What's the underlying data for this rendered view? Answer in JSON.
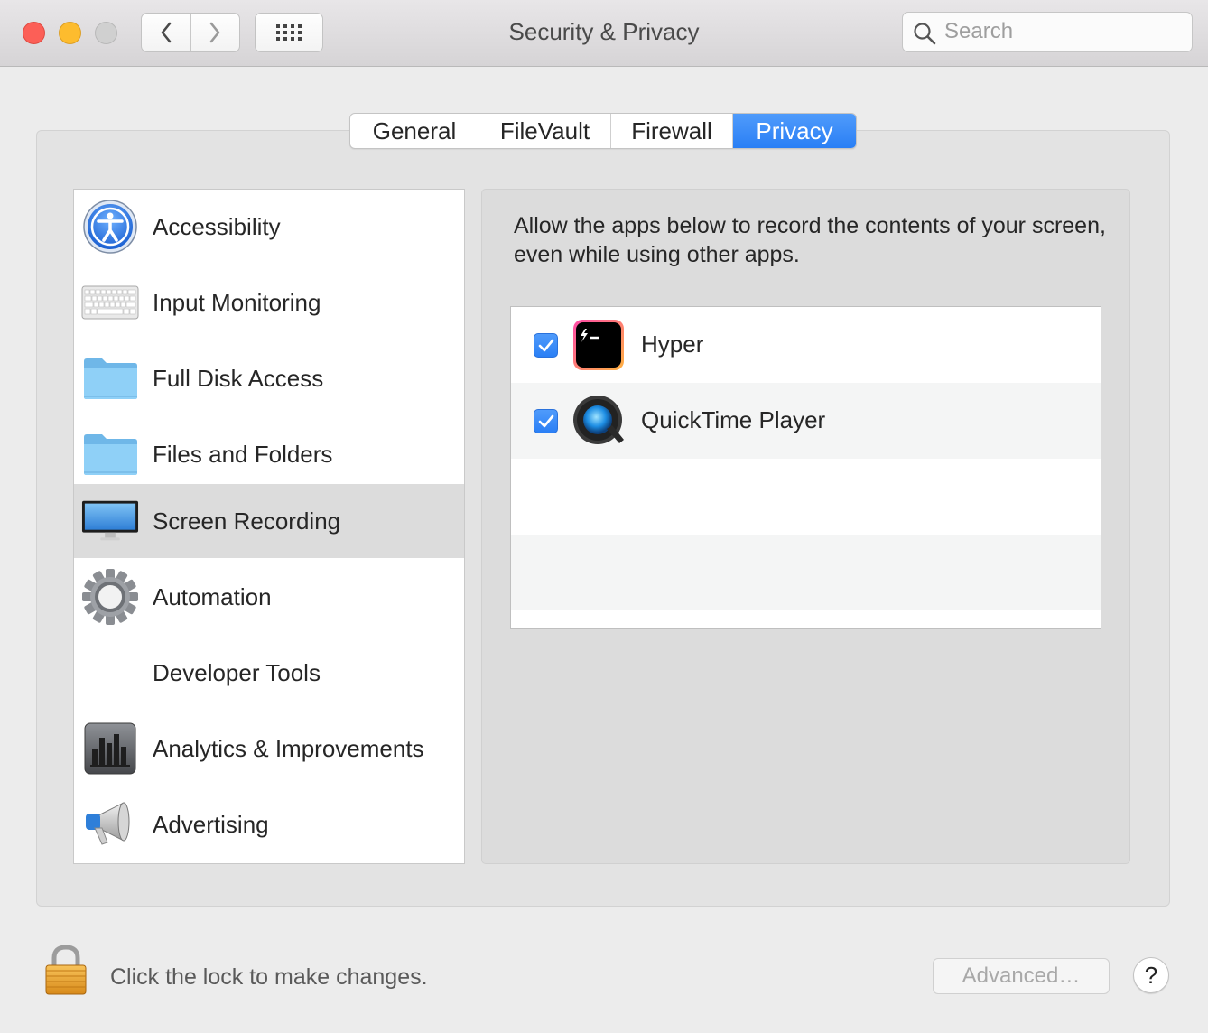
{
  "window": {
    "title": "Security & Privacy"
  },
  "toolbar": {
    "back_icon": "chevron-left-icon",
    "forward_icon": "chevron-right-icon",
    "grid_icon": "show-all-grid-icon"
  },
  "search": {
    "placeholder": "Search",
    "value": ""
  },
  "tabs": [
    {
      "label": "General",
      "active": false
    },
    {
      "label": "FileVault",
      "active": false
    },
    {
      "label": "Firewall",
      "active": false
    },
    {
      "label": "Privacy",
      "active": true
    }
  ],
  "sidebar": {
    "items": [
      {
        "label": "Accessibility",
        "icon": "accessibility-icon",
        "selected": false
      },
      {
        "label": "Input Monitoring",
        "icon": "keyboard-icon",
        "selected": false
      },
      {
        "label": "Full Disk Access",
        "icon": "folder-icon",
        "selected": false
      },
      {
        "label": "Files and Folders",
        "icon": "folder-icon",
        "selected": false
      },
      {
        "label": "Screen Recording",
        "icon": "display-icon",
        "selected": true
      },
      {
        "label": "Automation",
        "icon": "gear-icon",
        "selected": false
      },
      {
        "label": "Developer Tools",
        "icon": "",
        "selected": false
      },
      {
        "label": "Analytics & Improvements",
        "icon": "bar-chart-icon",
        "selected": false
      },
      {
        "label": "Advertising",
        "icon": "megaphone-icon",
        "selected": false
      }
    ]
  },
  "main": {
    "description": "Allow the apps below to record the contents of your screen, even while using other apps.",
    "apps": [
      {
        "name": "Hyper",
        "checked": true,
        "icon": "hyper-terminal-icon"
      },
      {
        "name": "QuickTime Player",
        "checked": true,
        "icon": "quicktime-icon"
      }
    ]
  },
  "footer": {
    "lock_text": "Click the lock to make changes.",
    "advanced_label": "Advanced…",
    "help_label": "?"
  },
  "colors": {
    "accent": "#2a7ff5",
    "selected_row": "#dcdcdc",
    "close": "#fc5f57",
    "minimize": "#fdbc2e"
  }
}
